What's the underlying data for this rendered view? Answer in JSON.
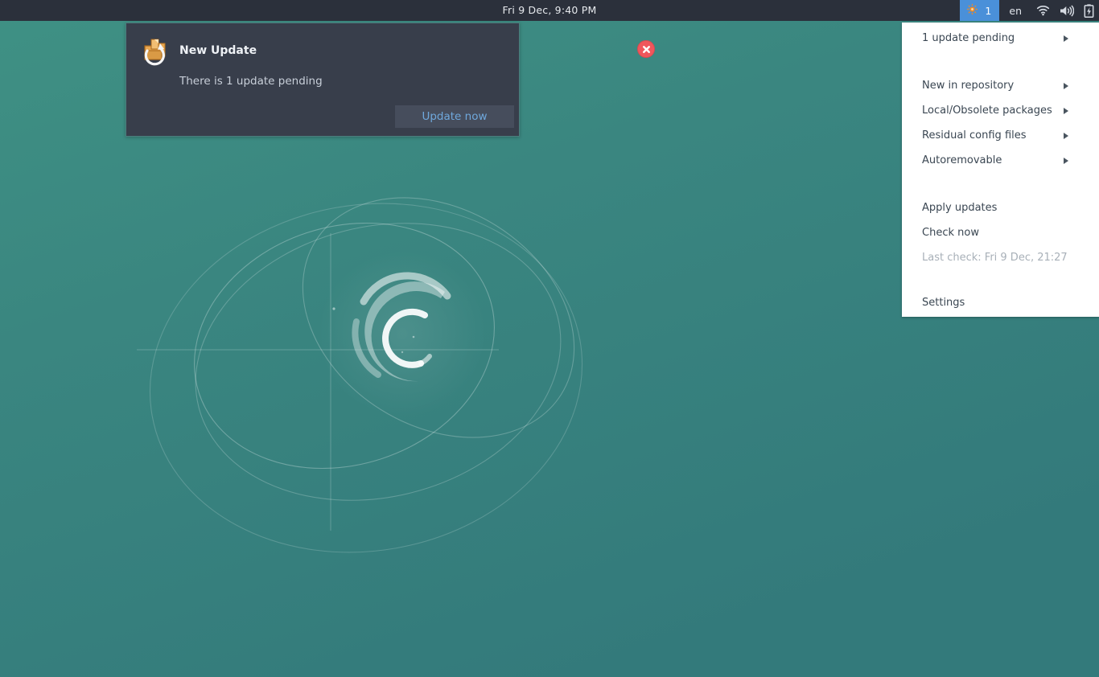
{
  "desktop": {
    "wallpaper_name": "debian-swirl-teal",
    "bg_color_top": "#3d8d80",
    "bg_color_bottom": "#33797a"
  },
  "panel": {
    "clock": "Fri  9 Dec,  9:40 PM",
    "background": "#2b303b",
    "tray": {
      "updates": {
        "icon": "update-sun-icon",
        "count": "1",
        "highlight_color": "#4a90d9"
      },
      "keyboard_layout": "en",
      "icons": [
        {
          "name": "wifi-icon",
          "label": "Wireless network"
        },
        {
          "name": "volume-icon",
          "label": "Volume"
        },
        {
          "name": "battery-charging-icon",
          "label": "Battery charging"
        }
      ]
    }
  },
  "notification": {
    "icon": "package-update-icon",
    "title": "New Update",
    "body": "There is 1 update pending",
    "action_label": "Update now",
    "close_label": "×",
    "background": "#383e4b",
    "border_color": "#4c7d7d",
    "close_color": "#f0565c",
    "action_text_color": "#6fa8dc"
  },
  "update_menu": {
    "background": "#ffffff",
    "items": [
      {
        "label": "1 update pending",
        "submenu": true,
        "disabled": false
      },
      {
        "label": "New in repository",
        "submenu": true,
        "disabled": false
      },
      {
        "label": "Local/Obsolete packages",
        "submenu": true,
        "disabled": false
      },
      {
        "label": "Residual config files",
        "submenu": true,
        "disabled": false
      },
      {
        "label": "Autoremovable",
        "submenu": true,
        "disabled": false
      },
      {
        "label": "Apply updates",
        "submenu": false,
        "disabled": false
      },
      {
        "label": "Check now",
        "submenu": false,
        "disabled": false
      },
      {
        "label": "Last check: Fri 9 Dec, 21:27",
        "submenu": false,
        "disabled": true
      },
      {
        "label": "Settings",
        "submenu": false,
        "disabled": false
      }
    ]
  }
}
